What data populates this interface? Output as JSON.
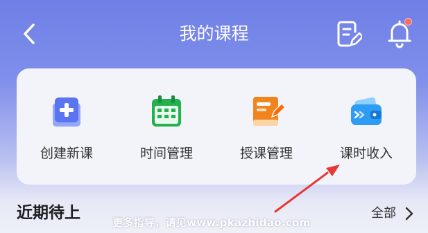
{
  "header": {
    "title": "我的课程",
    "back_icon": "chevron-left-icon",
    "notes_icon": "notes-edit-icon",
    "notification_icon": "bell-icon",
    "has_unread_notification": true
  },
  "quick_actions": [
    {
      "label": "创建新课",
      "icon": "add-course-icon",
      "color": "#5b74f0"
    },
    {
      "label": "时间管理",
      "icon": "calendar-icon",
      "color": "#22b14c"
    },
    {
      "label": "授课管理",
      "icon": "book-edit-icon",
      "color": "#f2841d"
    },
    {
      "label": "课时收入",
      "icon": "wallet-icon",
      "color": "#2f9cf4"
    }
  ],
  "upcoming": {
    "title": "近期待上",
    "view_all": "全部"
  },
  "watermark": "更多指导，请见www.pkazhidao.com",
  "colors": {
    "accent": "#6e7fe6",
    "annotation_arrow": "#e53935",
    "notification_dot": "#ff6b61"
  }
}
